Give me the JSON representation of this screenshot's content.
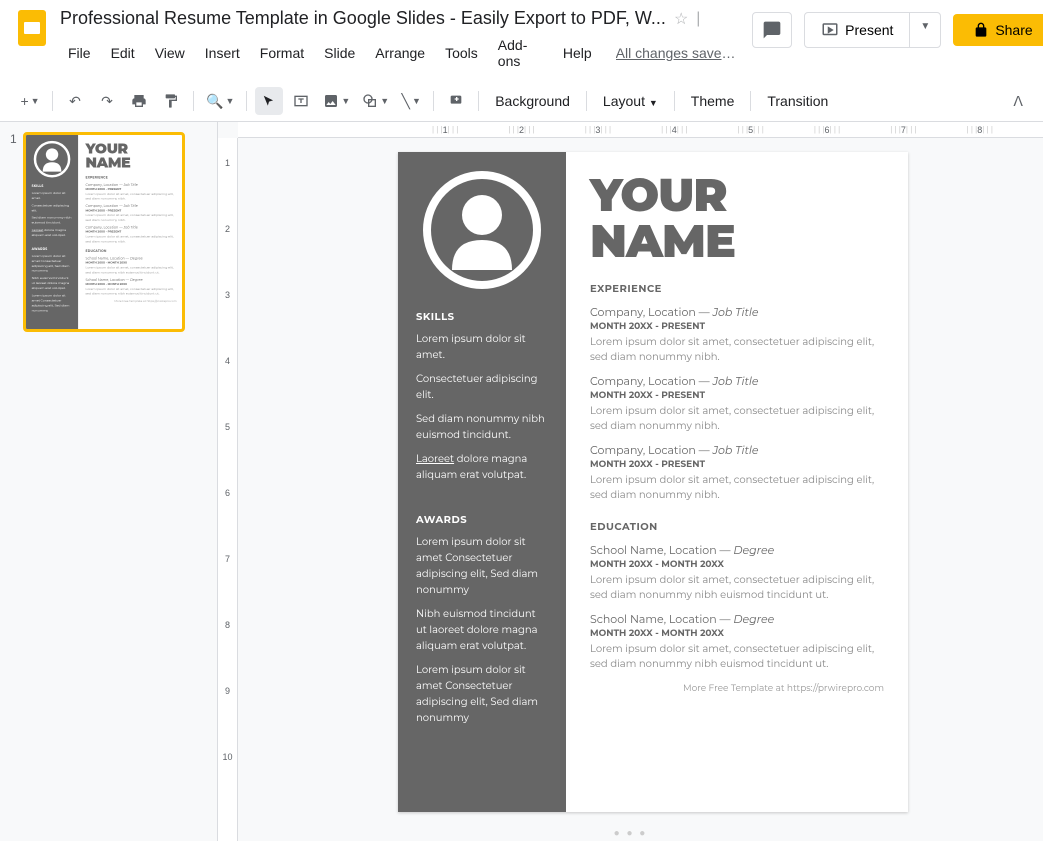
{
  "header": {
    "doc_title": "Professional Resume Template in Google Slides - Easily Export to PDF, W...",
    "save_status": "All changes saved in ...",
    "menus": [
      "File",
      "Edit",
      "View",
      "Insert",
      "Format",
      "Slide",
      "Arrange",
      "Tools",
      "Add-ons",
      "Help"
    ],
    "present": "Present",
    "share": "Share"
  },
  "toolbar": {
    "background": "Background",
    "layout": "Layout",
    "theme": "Theme",
    "transition": "Transition"
  },
  "sidebar": {
    "slide_num": "1"
  },
  "resume": {
    "name1": "YOUR",
    "name2": "NAME",
    "skills_h": "SKILLS",
    "skills": [
      "Lorem ipsum dolor sit amet.",
      "Consectetuer adipiscing elit.",
      "Sed diam nonummy nibh euismod tincidunt.",
      "Laoreet dolore magna aliquam erat volutpat."
    ],
    "awards_h": "AWARDS",
    "awards": [
      "Lorem ipsum dolor sit amet Consectetuer adipiscing elit, Sed diam nonummy",
      "Nibh euismod tincidunt ut laoreet dolore magna aliquam erat volutpat.",
      "Lorem ipsum dolor sit amet Consectetuer adipiscing elit, Sed diam nonummy"
    ],
    "exp_h": "EXPERIENCE",
    "exp": [
      {
        "title": "Company, Location — ",
        "role": "Job Title",
        "date": "MONTH 20XX - PRESENT",
        "desc": "Lorem ipsum dolor sit amet, consectetuer adipiscing elit, sed diam nonummy nibh."
      },
      {
        "title": "Company, Location — ",
        "role": "Job Title",
        "date": "MONTH 20XX - PRESENT",
        "desc": "Lorem ipsum dolor sit amet, consectetuer adipiscing elit, sed diam nonummy nibh."
      },
      {
        "title": "Company, Location — ",
        "role": "Job Title",
        "date": "MONTH 20XX - PRESENT",
        "desc": "Lorem ipsum dolor sit amet, consectetuer adipiscing elit, sed diam nonummy nibh."
      }
    ],
    "edu_h": "EDUCATION",
    "edu": [
      {
        "title": "School Name, Location — ",
        "role": "Degree",
        "date": "MONTH 20XX - MONTH 20XX",
        "desc": "Lorem ipsum dolor sit amet, consectetuer adipiscing elit, sed diam nonummy nibh euismod tincidunt ut."
      },
      {
        "title": "School Name, Location — ",
        "role": "Degree",
        "date": "MONTH 20XX - MONTH 20XX",
        "desc": "Lorem ipsum dolor sit amet, consectetuer adipiscing elit, sed diam nonummy nibh euismod tincidunt ut."
      }
    ],
    "footer_text": "More Free Template at ",
    "footer_link": "https://prwirepro.com"
  },
  "ruler_h": [
    "1",
    "2",
    "3",
    "4",
    "5",
    "6",
    "7",
    "8"
  ],
  "ruler_v": [
    "1",
    "2",
    "3",
    "4",
    "5",
    "6",
    "7",
    "8",
    "9",
    "10"
  ]
}
